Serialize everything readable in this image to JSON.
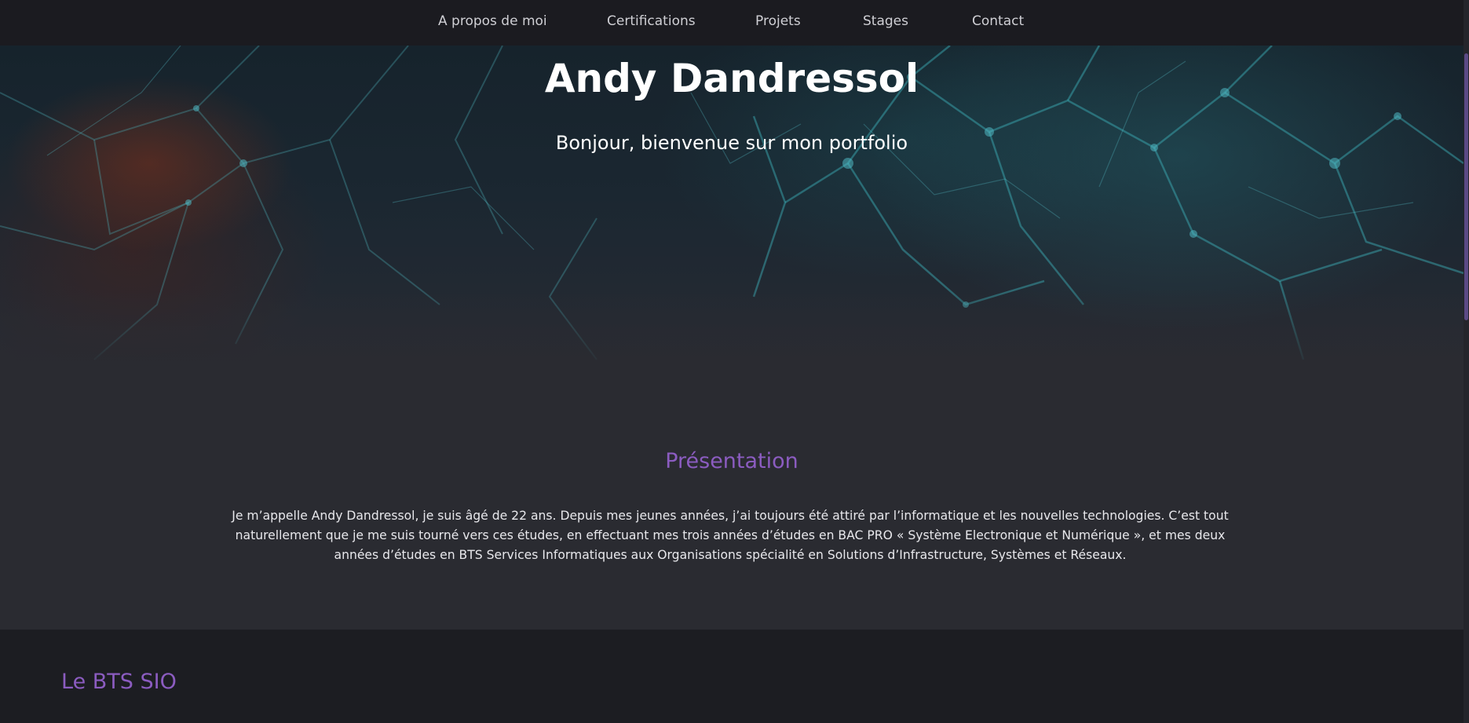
{
  "nav": {
    "items": [
      {
        "label": "A propos de moi"
      },
      {
        "label": "Certifications"
      },
      {
        "label": "Projets"
      },
      {
        "label": "Stages"
      },
      {
        "label": "Contact"
      }
    ]
  },
  "hero": {
    "title": "Andy Dandressol",
    "subtitle": "Bonjour, bienvenue sur mon portfolio"
  },
  "presentation": {
    "title": "Présentation",
    "text_lines": [
      "Je m’appelle Andy Dandressol, je suis âgé de 22 ans. Depuis mes jeunes années, j’ai toujours été attiré par l’informatique et les nouvelles technologies. C’est tout",
      "naturellement que je me suis tourné vers ces études, en effectuant mes trois années d’études en BAC PRO « Système Electronique et Numérique », et mes deux",
      "années d’études en BTS Services Informatiques aux Organisations spécialité en Solutions d’Infrastructure, Systèmes et Réseaux."
    ]
  },
  "bts": {
    "title": "Le BTS SIO"
  },
  "colors": {
    "accent": "#8b5cc0",
    "nav_bg": "#1b1b20",
    "section_bg": "#2a2b31",
    "page_bg": "#1c1d22"
  }
}
